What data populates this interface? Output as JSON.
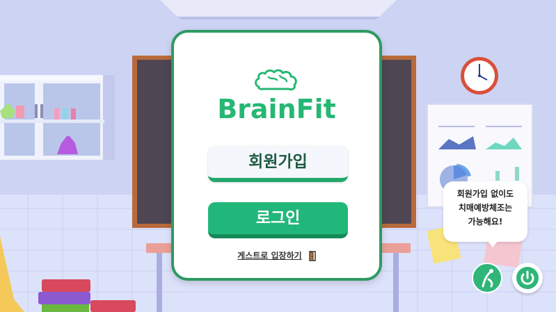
{
  "app": {
    "logo_text": "BrainFit"
  },
  "auth": {
    "signup_label": "회원가입",
    "login_label": "로그인",
    "guest_label": "게스트로 입장하기"
  },
  "bubble": {
    "lines": [
      "회원가입 없이도",
      "치매예방체조는",
      "가능해요!"
    ]
  },
  "icons": {
    "brain": "brain-icon",
    "door": "door-exit-icon",
    "character": "running-character-icon",
    "power": "power-icon",
    "clock": "wall-clock-icon"
  },
  "colors": {
    "brand_green": "#27b774",
    "card_border": "#2e9a63",
    "login_bg": "#21b77a",
    "signup_text": "#1f5a43"
  }
}
